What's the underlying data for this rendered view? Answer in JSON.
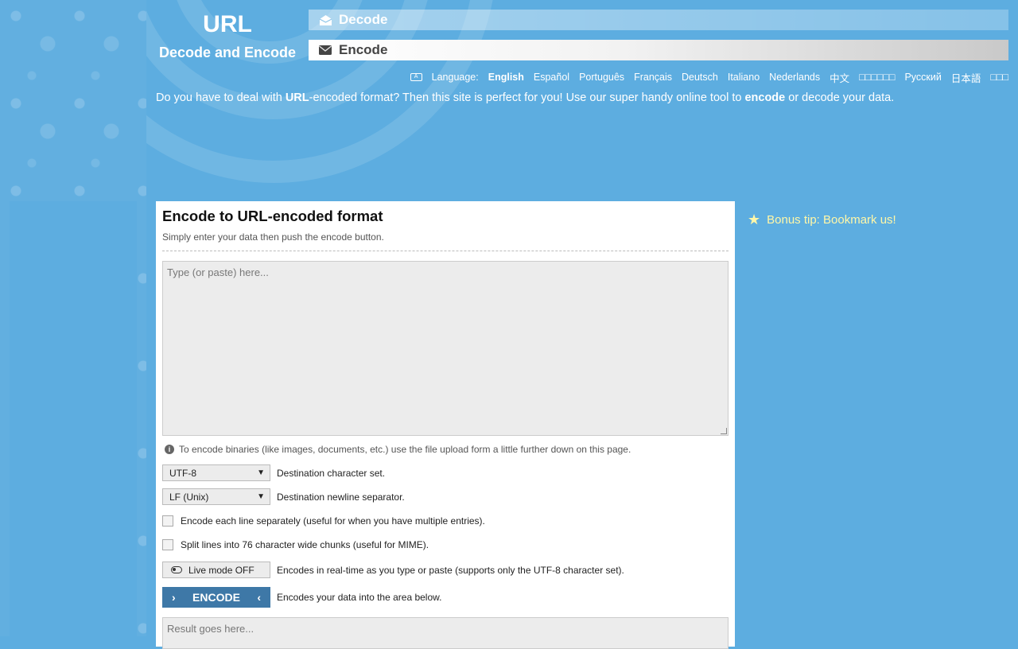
{
  "logo": {
    "title": "URL",
    "subtitle": "Decode and Encode"
  },
  "nav": {
    "decode_label": "Decode",
    "encode_label": "Encode"
  },
  "language": {
    "label": "Language:",
    "items": [
      "English",
      "Español",
      "Português",
      "Français",
      "Deutsch",
      "Italiano",
      "Nederlands",
      "中文",
      "□□□□□□",
      "Русский",
      "日本語",
      "□□□"
    ],
    "active": "English"
  },
  "tagline": {
    "part1": "Do you have to deal with ",
    "bold1": "URL",
    "part2": "-encoded format? Then this site is perfect for you! Use our super handy online tool to ",
    "bold2": "encode",
    "part3": " or decode your data."
  },
  "panel": {
    "title": "Encode to URL-encoded format",
    "subtitle": "Simply enter your data then push the encode button.",
    "input_placeholder": "Type (or paste) here...",
    "info_text": "To encode binaries (like images, documents, etc.) use the file upload form a little further down on this page.",
    "charset_value": "UTF-8",
    "charset_desc": "Destination character set.",
    "newline_value": "LF (Unix)",
    "newline_desc": "Destination newline separator.",
    "each_line_label": "Encode each line separately (useful for when you have multiple entries).",
    "split_lines_label": "Split lines into 76 character wide chunks (useful for MIME).",
    "live_mode_label": "Live mode OFF",
    "live_mode_desc": "Encodes in real-time as you type or paste (supports only the UTF-8 character set).",
    "encode_button_label": "ENCODE",
    "encode_desc": "Encodes your data into the area below.",
    "result_placeholder": "Result goes here..."
  },
  "bonus_tip": "Bonus tip: Bookmark us!",
  "colors": {
    "background": "#5dade0",
    "encode_button": "#3e78a7",
    "bonus_text": "#fff7a8"
  }
}
